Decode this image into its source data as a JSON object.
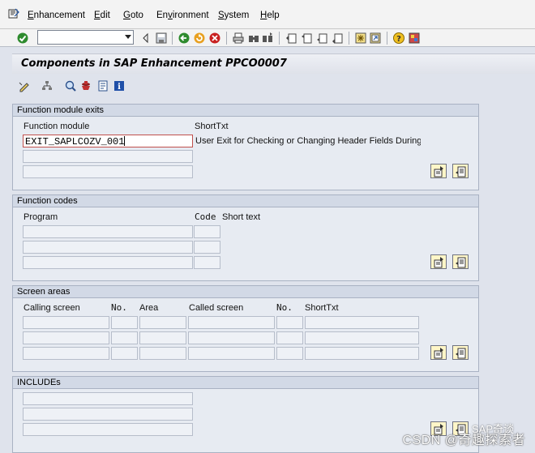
{
  "menu": {
    "items": [
      "Enhancement",
      "Edit",
      "Goto",
      "Environment",
      "System",
      "Help"
    ],
    "accels": [
      "E",
      "E",
      "G",
      "v",
      "S",
      "H"
    ]
  },
  "toolbar": {
    "command_field_value": "",
    "icons": [
      "enter-icon",
      "back-icon",
      "exit-icon",
      "cancel-icon",
      "print-icon",
      "find-icon",
      "find-next-icon",
      "first-page-icon",
      "prev-page-icon",
      "next-page-icon",
      "last-page-icon",
      "new-session-icon",
      "shortcut-icon",
      "help-icon",
      "customize-layout-icon"
    ]
  },
  "title": "Components in SAP Enhancement PPCO0007",
  "groups": {
    "fm_exits": {
      "title": "Function module exits",
      "col_function_module": "Function module",
      "col_short_text": "ShortTxt",
      "rows": [
        {
          "function_module": "EXIT_SAPLCOZV_001",
          "short_text": "User Exit for Checking or Changing Header Fields During Orc"
        },
        {
          "function_module": "",
          "short_text": ""
        },
        {
          "function_module": "",
          "short_text": ""
        }
      ]
    },
    "fcodes": {
      "title": "Function codes",
      "col_program": "Program",
      "col_code": "Code",
      "col_short_text": "Short text"
    },
    "screens": {
      "title": "Screen areas",
      "col_calling_screen": "Calling screen",
      "col_no1": "No.",
      "col_area": "Area",
      "col_called_screen": "Called screen",
      "col_no2": "No.",
      "col_short_text": "ShortTxt"
    },
    "includes": {
      "title": "INCLUDEs"
    }
  },
  "watermark": "CSDN @奇趣探索者",
  "watermark_small": "SAP奇谈",
  "colors": {
    "background": "#dfe3ec",
    "group_header": "#d2d9e6",
    "button_face": "#fff6c8",
    "active_border": "#c0504d"
  }
}
